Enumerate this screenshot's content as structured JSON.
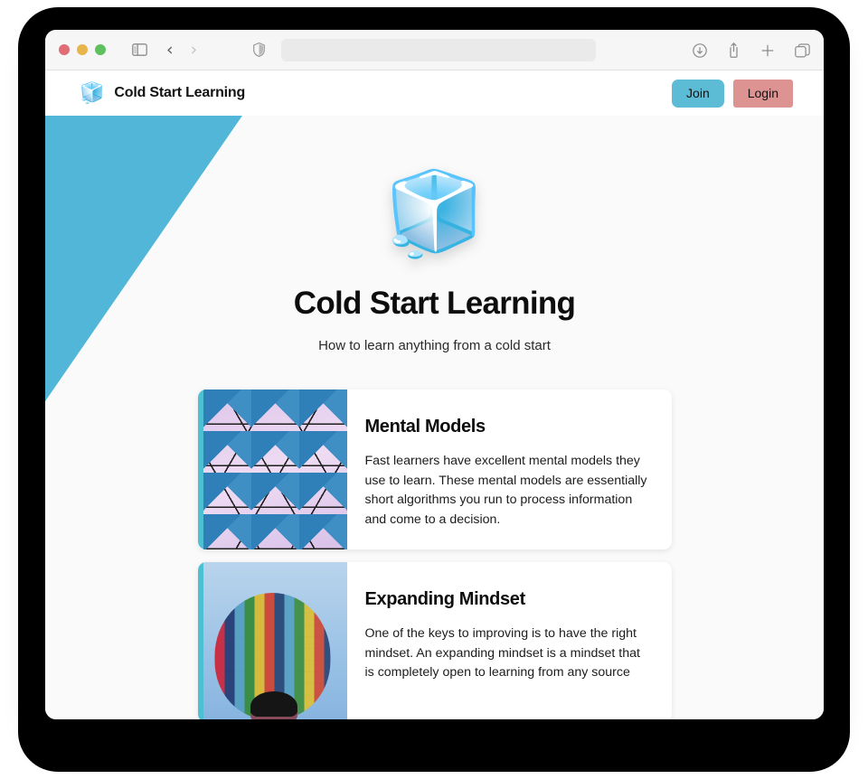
{
  "browser": {
    "traffic_lights": [
      "close",
      "minimize",
      "maximize"
    ],
    "sidebar_toggle_icon": "sidebar-icon",
    "back_icon": "chevron-left-icon",
    "forward_icon": "chevron-right-icon",
    "shield_icon": "shield-icon",
    "address_bar_value": "",
    "address_bar_placeholder": "",
    "right_icons": [
      {
        "name": "downloads-icon",
        "glyph": "download"
      },
      {
        "name": "share-icon",
        "glyph": "share"
      },
      {
        "name": "new-tab-icon",
        "glyph": "plus"
      },
      {
        "name": "tab-overview-icon",
        "glyph": "tabs"
      }
    ]
  },
  "header": {
    "brand_icon": "🧊",
    "brand_name": "Cold Start Learning",
    "join_label": "Join",
    "login_label": "Login",
    "join_color": "#5cbcd6",
    "login_color": "#de9393"
  },
  "hero": {
    "emoji": "🧊",
    "title": "Cold Start Learning",
    "subtitle": "How to learn anything from a cold start"
  },
  "theme": {
    "accent_teal": "#51b6d7",
    "card_accent": "#4ec0d4",
    "page_background": "#fafafa",
    "text_color": "#0d0d0d"
  },
  "cards": [
    {
      "title": "Mental Models",
      "text": "Fast learners have excellent mental models they use to learn. These mental models are essentially short algorithms you run to process information and come to a decision.",
      "thumb_name": "geometric-triangles-image"
    },
    {
      "title": "Expanding Mindset",
      "text": "One of the keys to improving is to have the right mindset. An expanding mindset is a mindset that is completely open to learning from any source",
      "thumb_name": "hot-air-balloon-image"
    }
  ]
}
